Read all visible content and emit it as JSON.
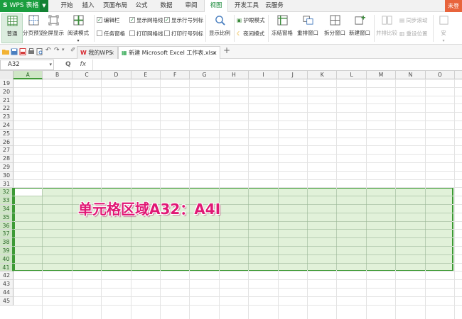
{
  "app": {
    "button_label": "WPS 表格",
    "logo_letter": "S",
    "login_label": "未登"
  },
  "menu": {
    "tabs": [
      "开始",
      "插入",
      "页面布局",
      "公式",
      "数据",
      "审阅",
      "视图",
      "开发工具",
      "云服务"
    ],
    "active_tab": "视图"
  },
  "ribbon": {
    "normal": "普通",
    "page_break": "分页预览",
    "fullscreen": "全屏显示",
    "reading_mode": "阅读模式",
    "edit_bar": "编辑栏",
    "task_pane": "任务窗格",
    "show_gridlines": "显示网格线",
    "print_gridlines": "打印网格线",
    "show_headers": "显示行号列标",
    "print_headers": "打印行号列标",
    "zoom": "显示比例",
    "eye_protection": "护眼模式",
    "night_mode": "夜间模式",
    "freeze_panes": "冻结窗格",
    "rearrange_windows": "重排窗口",
    "split_window": "拆分窗口",
    "new_window": "新建窗口",
    "side_by_side": "并排比较",
    "sync_scroll": "同步滚动",
    "reset_position": "重设位置",
    "hide": "安"
  },
  "doc_tabs": [
    {
      "label": "我的WPS",
      "active": false
    },
    {
      "label": "新建 Microsoft Excel 工作表.xlsx *",
      "active": true
    }
  ],
  "formula_bar": {
    "name_box": "A32",
    "fx": "fx",
    "zoom_glyph": "Q",
    "value": ""
  },
  "sheet": {
    "columns": [
      "A",
      "B",
      "C",
      "D",
      "E",
      "F",
      "G",
      "H",
      "I",
      "J",
      "K",
      "L",
      "M",
      "N",
      "O"
    ],
    "rows": [
      19,
      20,
      21,
      22,
      23,
      24,
      25,
      26,
      27,
      28,
      29,
      30,
      31,
      32,
      33,
      34,
      35,
      36,
      37,
      38,
      39,
      40,
      41,
      42,
      43,
      44,
      45
    ],
    "selection": {
      "range": "A32:A4I",
      "first_row": 32,
      "last_row": 41
    },
    "annotation": "单元格区域A32：A4I"
  },
  "colors": {
    "accent": "#1a9e3f",
    "selection_border": "#3c9a33",
    "annotation": "#e01874",
    "login": "#e8643c"
  }
}
